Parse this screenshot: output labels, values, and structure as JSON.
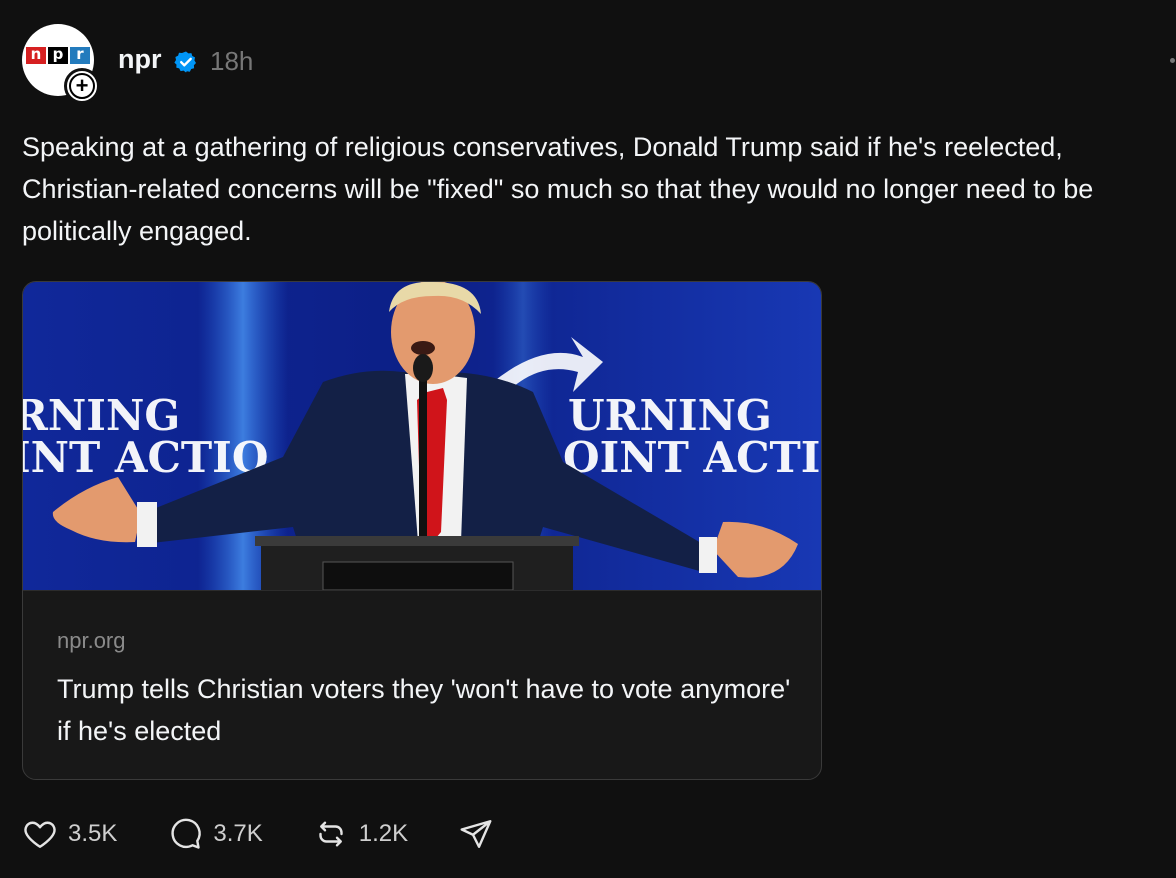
{
  "header": {
    "avatar_letters": [
      "n",
      "p",
      "r"
    ],
    "username": "npr",
    "verified_icon": "verified-badge-icon",
    "timestamp": "18h",
    "follow_icon": "plus-icon"
  },
  "post": {
    "text": "Speaking at a gathering of religious conservatives, Donald Trump said if he's reelected, Christian-related concerns will be \"fixed\" so much so that they would no longer need to be politically engaged."
  },
  "link_card": {
    "image_text_left_top": "RNING",
    "image_text_left_bottom": "INT ACTIO",
    "image_text_right_top": "URNING",
    "image_text_right_bottom": "OINT ACTIC",
    "domain": "npr.org",
    "title": "Trump tells Christian voters they 'won't have to vote anymore' if he's elected"
  },
  "actions": {
    "like": {
      "icon": "heart-icon",
      "count": "3.5K"
    },
    "reply": {
      "icon": "comment-icon",
      "count": "3.7K"
    },
    "repost": {
      "icon": "repost-icon",
      "count": "1.2K"
    },
    "share": {
      "icon": "send-icon"
    }
  },
  "colors": {
    "background": "#101010",
    "verified": "#0095f6",
    "muted": "#777777",
    "image_blue": "#1432a8"
  }
}
